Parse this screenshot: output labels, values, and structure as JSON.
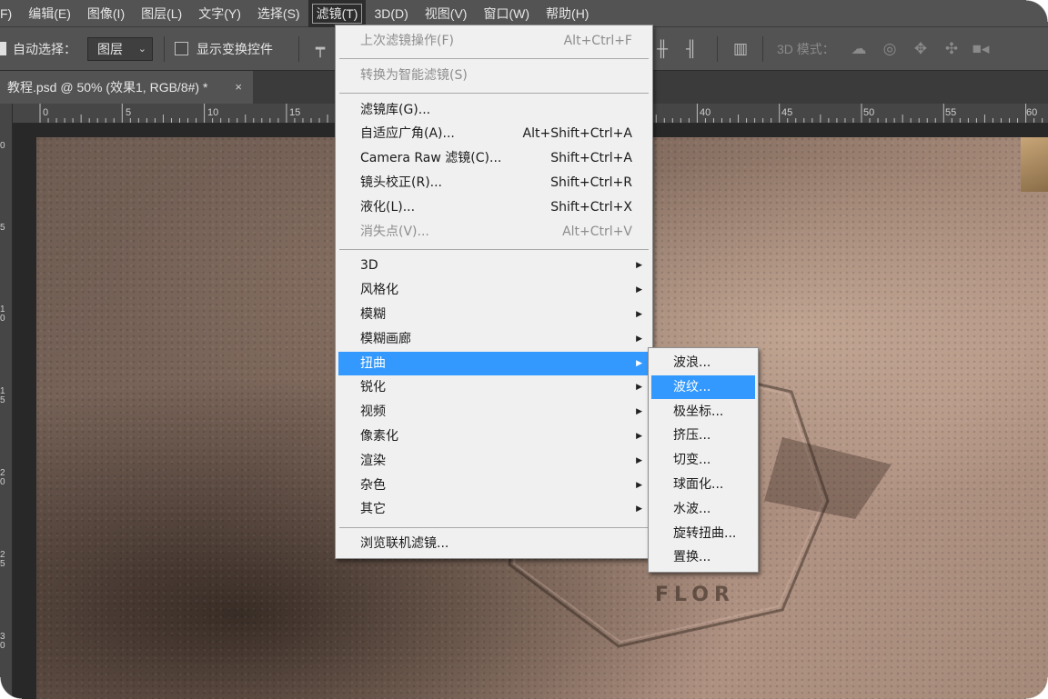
{
  "menubar": {
    "items": [
      {
        "label": "F)"
      },
      {
        "label": "编辑(E)"
      },
      {
        "label": "图像(I)"
      },
      {
        "label": "图层(L)"
      },
      {
        "label": "文字(Y)"
      },
      {
        "label": "选择(S)"
      },
      {
        "label": "滤镜(T)"
      },
      {
        "label": "3D(D)"
      },
      {
        "label": "视图(V)"
      },
      {
        "label": "窗口(W)"
      },
      {
        "label": "帮助(H)"
      }
    ],
    "active_index": 6
  },
  "options": {
    "auto_select_label": "自动选择：",
    "auto_select_value": "图层",
    "show_transform_label": "显示变换控件",
    "mode_3d_label": "3D 模式："
  },
  "document_tab": {
    "title": "教程.psd @ 50% (效果1, RGB/8#) *",
    "close": "×"
  },
  "ruler_top": {
    "labels": [
      "0",
      "5",
      "10",
      "15",
      "40",
      "45",
      "50",
      "55",
      "60"
    ]
  },
  "ruler_left": {
    "labels": [
      "0",
      "5",
      "1\n0",
      "1\n5",
      "2\n0",
      "2\n5",
      "3\n0"
    ]
  },
  "filter_menu": {
    "sections": [
      [
        {
          "label": "上次滤镜操作(F)",
          "shortcut": "Alt+Ctrl+F",
          "disabled": true
        }
      ],
      [
        {
          "label": "转换为智能滤镜(S)",
          "shortcut": "",
          "disabled": true
        }
      ],
      [
        {
          "label": "滤镜库(G)...",
          "shortcut": ""
        },
        {
          "label": "自适应广角(A)...",
          "shortcut": "Alt+Shift+Ctrl+A"
        },
        {
          "label": "Camera Raw 滤镜(C)...",
          "shortcut": "Shift+Ctrl+A"
        },
        {
          "label": "镜头校正(R)...",
          "shortcut": "Shift+Ctrl+R"
        },
        {
          "label": "液化(L)...",
          "shortcut": "Shift+Ctrl+X"
        },
        {
          "label": "消失点(V)...",
          "shortcut": "Alt+Ctrl+V",
          "disabled": true
        }
      ],
      [
        {
          "label": "3D",
          "submenu": true
        },
        {
          "label": "风格化",
          "submenu": true
        },
        {
          "label": "模糊",
          "submenu": true
        },
        {
          "label": "模糊画廊",
          "submenu": true
        },
        {
          "label": "扭曲",
          "submenu": true,
          "highlighted": true
        },
        {
          "label": "锐化",
          "submenu": true
        },
        {
          "label": "视频",
          "submenu": true
        },
        {
          "label": "像素化",
          "submenu": true
        },
        {
          "label": "渲染",
          "submenu": true
        },
        {
          "label": "杂色",
          "submenu": true
        },
        {
          "label": "其它",
          "submenu": true
        }
      ],
      [
        {
          "label": "浏览联机滤镜..."
        }
      ]
    ]
  },
  "distort_submenu": {
    "items": [
      {
        "label": "波浪..."
      },
      {
        "label": "波纹...",
        "highlighted": true
      },
      {
        "label": "极坐标..."
      },
      {
        "label": "挤压..."
      },
      {
        "label": "切变..."
      },
      {
        "label": "球面化..."
      },
      {
        "label": "水波..."
      },
      {
        "label": "旋转扭曲..."
      },
      {
        "label": "置换..."
      }
    ]
  },
  "embossed_text": "FLOR",
  "colors": {
    "menu_highlight": "#3399ff",
    "menubar_bg": "#535353"
  },
  "icons": {
    "submenu_arrow": "▶",
    "dropdown_chevron": "⌄"
  }
}
